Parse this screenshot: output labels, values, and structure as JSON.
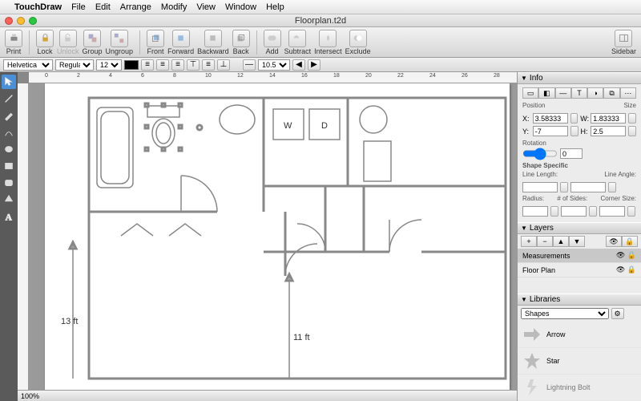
{
  "menu": {
    "items": [
      "TouchDraw",
      "File",
      "Edit",
      "Arrange",
      "Modify",
      "View",
      "Window",
      "Help"
    ]
  },
  "window": {
    "title": "Floorplan.t2d"
  },
  "toolbar": {
    "print": "Print",
    "lock": "Lock",
    "unlock": "Unlock",
    "group": "Group",
    "ungroup": "Ungroup",
    "front": "Front",
    "forward": "Forward",
    "backward": "Backward",
    "back": "Back",
    "add": "Add",
    "subtract": "Subtract",
    "intersect": "Intersect",
    "exclude": "Exclude",
    "sidebar": "Sidebar"
  },
  "format": {
    "font": "Helvetica",
    "weight": "Regular",
    "size": "12",
    "stroke_w": "10.5"
  },
  "canvas": {
    "washer": "W",
    "dryer": "D",
    "meas1": "13 ft",
    "meas2": "11 ft",
    "zoom": "100%"
  },
  "info": {
    "title": "Info",
    "position_label": "Position",
    "size_label": "Size",
    "x": "3.58333",
    "w": "1.83333",
    "y": "-7",
    "h": "2.5",
    "rotation_label": "Rotation",
    "rotation": "0",
    "shape_specific": "Shape Specific",
    "line_length": "Line Length:",
    "line_angle": "Line Angle:",
    "radius": "Radius:",
    "sides": "# of Sides:",
    "corner": "Corner Size:"
  },
  "layers": {
    "title": "Layers",
    "measurements": "Measurements",
    "floorplan": "Floor Plan"
  },
  "libraries": {
    "title": "Libraries",
    "selected": "Shapes",
    "items": [
      "Arrow",
      "Star",
      "Lightning Bolt"
    ]
  }
}
